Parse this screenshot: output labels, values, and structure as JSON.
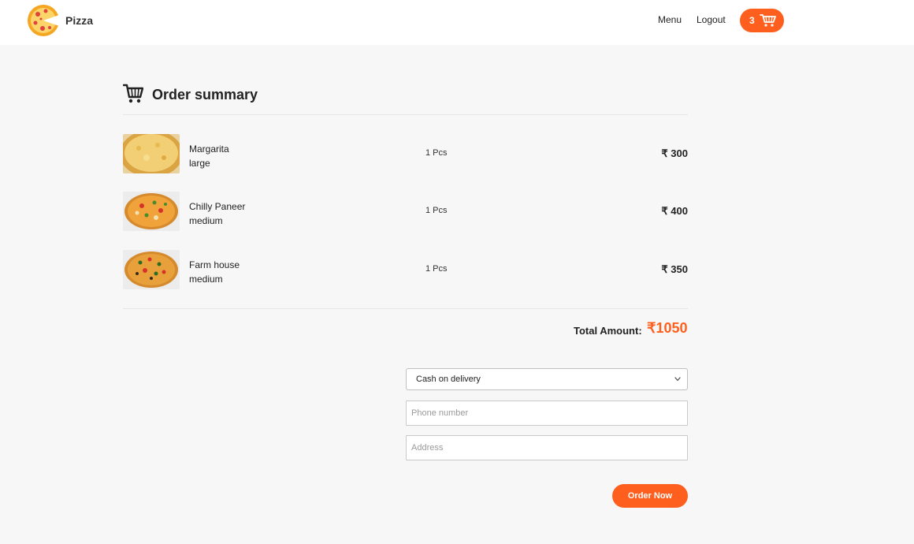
{
  "navbar": {
    "brand": "Pizza",
    "menu_label": "Menu",
    "logout_label": "Logout",
    "cart_count": "3"
  },
  "summary": {
    "title": "Order summary"
  },
  "items": [
    {
      "name": "Margarita",
      "size": "large",
      "qty": "1 Pcs",
      "price": "₹ 300"
    },
    {
      "name": "Chilly Paneer",
      "size": "medium",
      "qty": "1 Pcs",
      "price": "₹ 400"
    },
    {
      "name": "Farm house",
      "size": "medium",
      "qty": "1 Pcs",
      "price": "₹ 350"
    }
  ],
  "total": {
    "label": "Total Amount:",
    "value": "₹1050"
  },
  "form": {
    "payment_selected": "Cash on delivery",
    "phone_placeholder": "Phone number",
    "address_placeholder": "Address",
    "order_button": "Order Now"
  },
  "colors": {
    "accent": "#fe5f1e",
    "background": "#f7f7f7"
  }
}
